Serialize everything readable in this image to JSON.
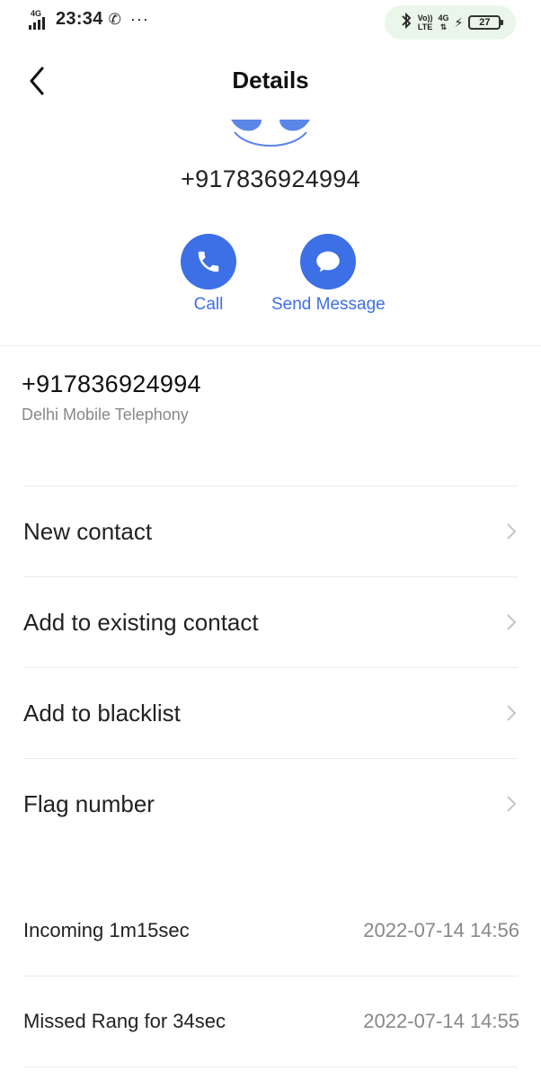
{
  "status_bar": {
    "network_type": "4G",
    "time": "23:34",
    "bt_icon": "bluetooth-icon",
    "volte_line1": "Vo))",
    "volte_line2": "LTE",
    "data_type": "4G",
    "battery_level": "27"
  },
  "header": {
    "title": "Details"
  },
  "contact": {
    "display_number": "+917836924994"
  },
  "actions": {
    "call_label": "Call",
    "message_label": "Send Message",
    "accent_color": "#3d6fe6"
  },
  "number_info": {
    "number": "+917836924994",
    "carrier": "Delhi Mobile Telephony"
  },
  "menu": {
    "items": [
      {
        "label": "New contact"
      },
      {
        "label": "Add to existing contact"
      },
      {
        "label": "Add to blacklist"
      },
      {
        "label": "Flag number"
      }
    ]
  },
  "call_log": [
    {
      "type": "Incoming 1m15sec",
      "time": "2022-07-14 14:56"
    },
    {
      "type": "Missed Rang for 34sec",
      "time": "2022-07-14 14:55"
    }
  ]
}
